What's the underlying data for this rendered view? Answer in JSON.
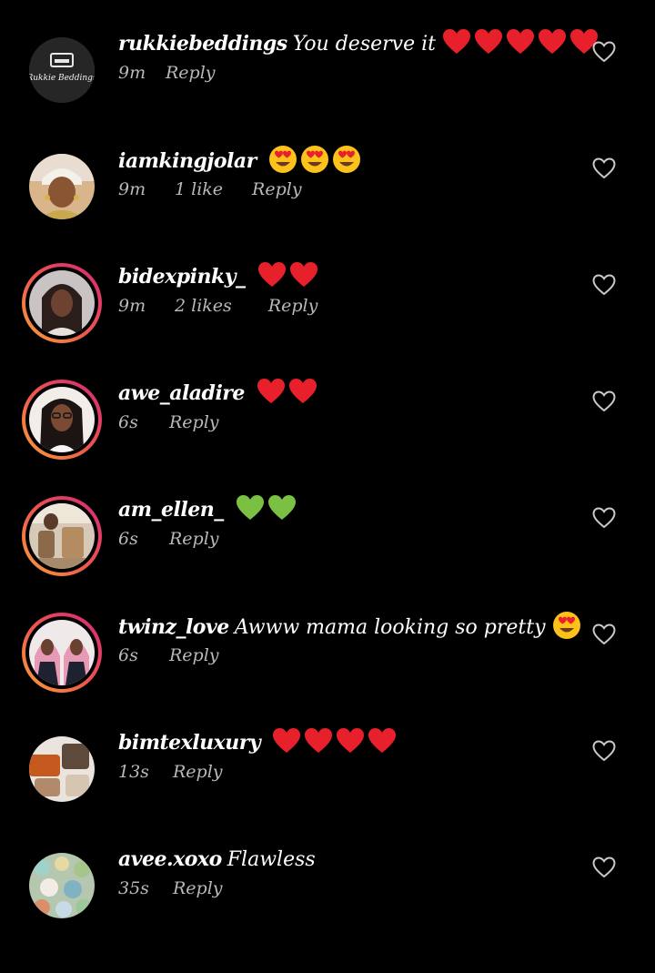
{
  "colors": {
    "background": "#000000",
    "text_primary": "#ffffff",
    "text_secondary": "#b9b9b9",
    "heart_red": "#e8202b",
    "heart_green": "#7ac143",
    "story_ring_start": "#f9a33c",
    "story_ring_end": "#d6247a"
  },
  "comments": [
    {
      "username": "rukkiebeddings",
      "text": "You deserve it",
      "emojis": [
        "red-heart",
        "red-heart",
        "red-heart",
        "red-heart",
        "red-heart"
      ],
      "time": "9m",
      "likes": "",
      "reply": "Reply",
      "story_ring": false,
      "avatar_text": "Rukkie Beddings",
      "like_icon": "heart-outline-icon"
    },
    {
      "username": "iamkingjolar",
      "text": "",
      "emojis": [
        "heart-eyes",
        "heart-eyes",
        "heart-eyes"
      ],
      "time": "9m",
      "likes": "1 like",
      "reply": "Reply",
      "story_ring": false,
      "like_icon": "heart-outline-icon"
    },
    {
      "username": "bidexpinky_",
      "text": "",
      "emojis": [
        "red-heart",
        "red-heart"
      ],
      "time": "9m",
      "likes": "2 likes",
      "reply": "Reply",
      "story_ring": true,
      "like_icon": "heart-outline-icon"
    },
    {
      "username": "awe_aladire",
      "text": "",
      "emojis": [
        "red-heart",
        "red-heart"
      ],
      "time": "6s",
      "likes": "",
      "reply": "Reply",
      "story_ring": true,
      "like_icon": "heart-outline-icon"
    },
    {
      "username": "am_ellen_",
      "text": "",
      "emojis": [
        "green-heart",
        "green-heart"
      ],
      "time": "6s",
      "likes": "",
      "reply": "Reply",
      "story_ring": true,
      "like_icon": "heart-outline-icon"
    },
    {
      "username": "twinz_love",
      "text": "Awww mama looking so pretty",
      "emojis": [
        "heart-eyes"
      ],
      "time": "6s",
      "likes": "",
      "reply": "Reply",
      "story_ring": true,
      "like_icon": "heart-outline-icon"
    },
    {
      "username": "bimtexluxury",
      "text": "",
      "emojis": [
        "red-heart",
        "red-heart",
        "red-heart",
        "red-heart"
      ],
      "time": "13s",
      "likes": "",
      "reply": "Reply",
      "story_ring": false,
      "like_icon": "heart-outline-icon"
    },
    {
      "username": "avee.xoxo",
      "text": "Flawless",
      "emojis": [],
      "time": "35s",
      "likes": "",
      "reply": "Reply",
      "story_ring": false,
      "like_icon": "heart-outline-icon"
    }
  ]
}
